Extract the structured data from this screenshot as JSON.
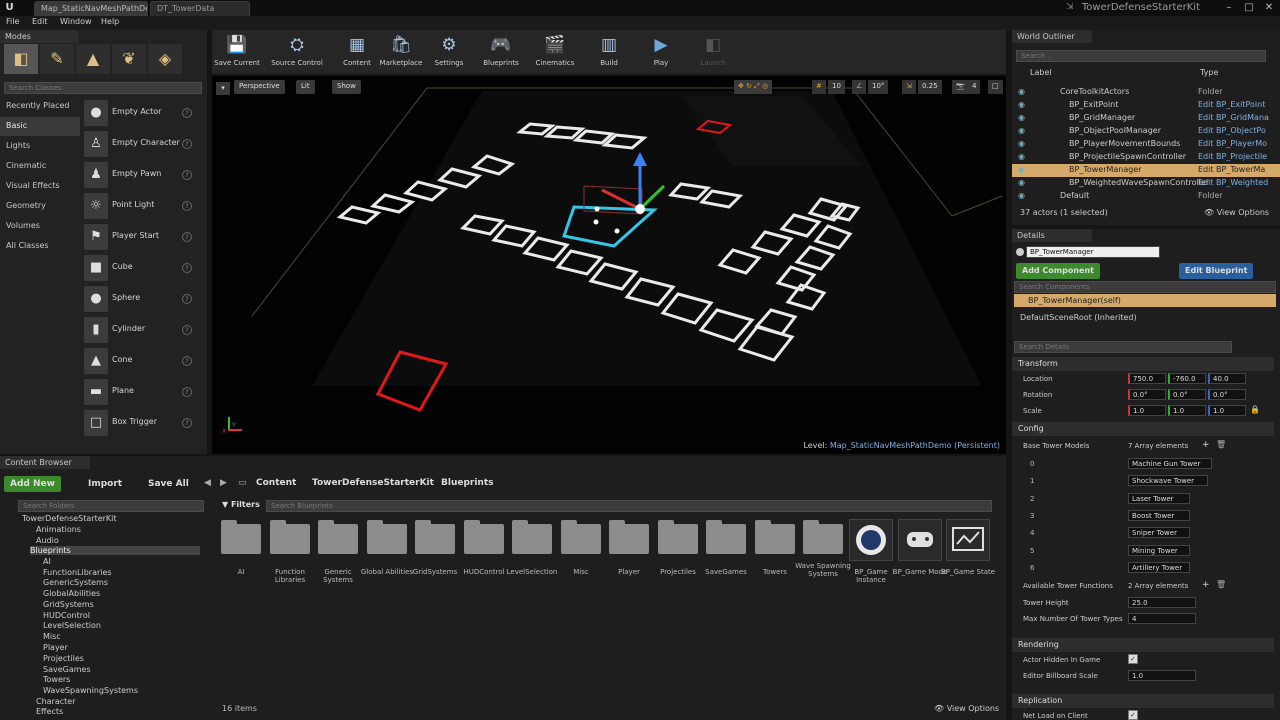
{
  "titlebar": {
    "tabs": [
      "Map_StaticNavMeshPathDen",
      "DT_TowerData"
    ],
    "app_title": "TowerDefenseStarterKit",
    "min": "–",
    "max": "□",
    "close": "✕"
  },
  "menu": [
    "File",
    "Edit",
    "Window",
    "Help"
  ],
  "modes": {
    "header": "Modes",
    "search_placeholder": "Search Classes",
    "categories": [
      "Recently Placed",
      "Basic",
      "Lights",
      "Cinematic",
      "Visual Effects",
      "Geometry",
      "Volumes",
      "All Classes"
    ],
    "items": [
      "Empty Actor",
      "Empty Character",
      "Empty Pawn",
      "Point Light",
      "Player Start",
      "Cube",
      "Sphere",
      "Cylinder",
      "Cone",
      "Plane",
      "Box Trigger"
    ]
  },
  "toolbar": {
    "buttons": [
      "Save Current",
      "Source Control",
      "Content",
      "Marketplace",
      "Settings",
      "Blueprints",
      "Cinematics",
      "Build",
      "Play",
      "Launch"
    ]
  },
  "viewport": {
    "perspective": "Perspective",
    "lit": "Lit",
    "show": "Show",
    "grid": "10",
    "rot": "10°",
    "scale": "0.25",
    "cam": "4",
    "level_prefix": "Level:",
    "level_name": "Map_StaticNavMeshPathDemo (Persistent)",
    "axis_x": "X",
    "axis_y": "Y"
  },
  "content_browser": {
    "header": "Content Browser",
    "add_new": "Add New",
    "import": "Import",
    "save_all": "Save All",
    "breadcrumb": [
      "Content",
      "TowerDefenseStarterKit",
      "Blueprints"
    ],
    "search_folders": "Search Folders",
    "filters": "Filters",
    "search_blueprints": "Search Blueprints",
    "tree": [
      "TowerDefenseStarterKit",
      "Animations",
      "Audio",
      "Blueprints",
      "AI",
      "FunctionLibraries",
      "GenericSystems",
      "GlobalAbilities",
      "GridSystems",
      "HUDControl",
      "LevelSelection",
      "Misc",
      "Player",
      "Projectiles",
      "SaveGames",
      "Towers",
      "WaveSpawningSystems",
      "Character",
      "Effects"
    ],
    "folders": [
      "AI",
      "Function Libraries",
      "Generic Systems",
      "Global Abilities",
      "GridSystems",
      "HUDControl",
      "LevelSelection",
      "Misc",
      "Player",
      "Projectiles",
      "SaveGames",
      "Towers",
      "Wave Spawning Systems"
    ],
    "assets": [
      "BP_Game Instance",
      "BP_Game Mode",
      "BP_Game State"
    ],
    "item_count": "16 items",
    "view_options": "View Options"
  },
  "outliner": {
    "header": "World Outliner",
    "search_placeholder": "Search...",
    "col_label": "Label",
    "col_type": "Type",
    "rows": [
      {
        "name": "CoreToolkitActors",
        "type": "Folder"
      },
      {
        "name": "BP_ExitPoint",
        "type": "Edit BP_ExitPoint"
      },
      {
        "name": "BP_GridManager",
        "type": "Edit BP_GridMana"
      },
      {
        "name": "BP_ObjectPoolManager",
        "type": "Edit BP_ObjectPo"
      },
      {
        "name": "BP_PlayerMovementBounds",
        "type": "Edit BP_PlayerMo"
      },
      {
        "name": "BP_ProjectileSpawnController",
        "type": "Edit BP_Projectile"
      },
      {
        "name": "BP_TowerManager",
        "type": "Edit BP_TowerMa"
      },
      {
        "name": "BP_WeightedWaveSpawnController",
        "type": "Edit BP_Weighted"
      },
      {
        "name": "Default",
        "type": "Folder"
      }
    ],
    "footer": "37 actors (1 selected)",
    "view_options": "View Options"
  },
  "details": {
    "header": "Details",
    "actor_name": "BP_TowerManager",
    "add_component": "Add Component",
    "edit_blueprint": "Edit Blueprint",
    "search_components": "Search Components",
    "self_component": "BP_TowerManager(self)",
    "root_component": "DefaultSceneRoot (Inherited)",
    "search_details": "Search Details",
    "transform": "Transform",
    "location_label": "Location",
    "location": [
      "750.0",
      "-760.0",
      "40.0"
    ],
    "rotation_label": "Rotation",
    "rotation": [
      "0.0°",
      "0.0°",
      "0.0°"
    ],
    "scale_label": "Scale",
    "scale": [
      "1.0",
      "1.0",
      "1.0"
    ],
    "config": "Config",
    "base_tower_models": "Base Tower Models",
    "base_tower_count": "7 Array elements",
    "towers": [
      "Machine Gun Tower",
      "Shockwave Tower",
      "Laser Tower",
      "Boost Tower",
      "Sniper Tower",
      "Mining Tower",
      "Artillery Tower"
    ],
    "available_tower_functions": "Available Tower Functions",
    "atf_count": "2 Array elements",
    "tower_height_label": "Tower Height",
    "tower_height": "25.0",
    "max_tower_types_label": "Max Number Of Tower Types",
    "max_tower_types": "4",
    "rendering": "Rendering",
    "actor_hidden_label": "Actor Hidden In Game",
    "billboard_label": "Editor Billboard Scale",
    "billboard_scale": "1.0",
    "replication": "Replication",
    "net_load_label": "Net Load on Client"
  }
}
